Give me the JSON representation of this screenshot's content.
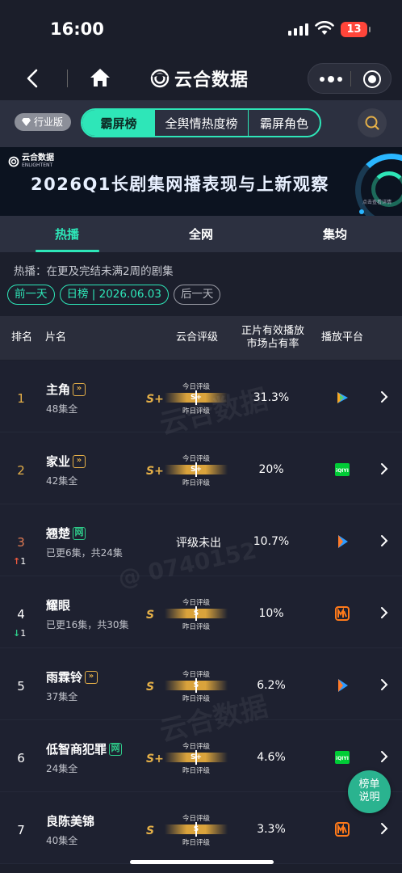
{
  "status": {
    "time": "16:00",
    "battery": "13"
  },
  "navbar": {
    "brand": "云合数据"
  },
  "top_tabs": {
    "industry": "行业版",
    "items": [
      "霸屏榜",
      "全舆情热度榜",
      "霸屏角色"
    ]
  },
  "banner": {
    "logo_main": "云合数据",
    "logo_sub": "ENLIGHTENT",
    "title": "2026Q1长剧集网播表现与上新观察",
    "note": "点击查看详情"
  },
  "sub_tabs": [
    "热播",
    "全网",
    "集均"
  ],
  "hint": "热播：在更及完结未满2周的剧集",
  "date_nav": {
    "prev": "前一天",
    "current": "日榜 | 2026.06.03",
    "next": "后一天"
  },
  "table_header": {
    "rank": "排名",
    "title": "片名",
    "grade": "云合评级",
    "share_line1": "正片有效播放",
    "share_line2": "市场占有率",
    "platform": "播放平台"
  },
  "grade_labels": {
    "today": "今日评级",
    "yesterday": "昨日评级"
  },
  "rows": [
    {
      "rank": "1",
      "title": "主角",
      "badge": "vip",
      "meta": "48集全",
      "grade": "S+",
      "share": "31.3%",
      "platform": "tencent"
    },
    {
      "rank": "2",
      "title": "家业",
      "badge": "vip",
      "meta": "42集全",
      "grade": "S+",
      "share": "20%",
      "platform": "iqiyi"
    },
    {
      "rank": "3",
      "delta": "1",
      "delta_dir": "up",
      "title": "翘楚",
      "badge": "net",
      "meta": "已更6集，共24集",
      "grade": "",
      "no_grade": "评级未出",
      "share": "10.7%",
      "platform": "youku"
    },
    {
      "rank": "4",
      "delta": "1",
      "delta_dir": "down",
      "title": "耀眼",
      "badge": "",
      "meta": "已更16集，共30集",
      "grade": "S",
      "share": "10%",
      "platform": "mango"
    },
    {
      "rank": "5",
      "title": "雨霖铃",
      "badge": "vip",
      "meta": "37集全",
      "grade": "S",
      "share": "6.2%",
      "platform": "youku"
    },
    {
      "rank": "6",
      "title": "低智商犯罪",
      "badge": "net",
      "meta": "24集全",
      "grade": "S+",
      "share": "4.6%",
      "platform": "iqiyi"
    },
    {
      "rank": "7",
      "title": "良陈美锦",
      "badge": "",
      "meta": "40集全",
      "grade": "S",
      "share": "3.3%",
      "platform": "mango"
    }
  ],
  "help_button": {
    "line1": "榜单",
    "line2": "说明"
  },
  "watermarks": {
    "brand": "云合数据",
    "brand_en": "ENLIGHTENT",
    "code": "@ 0740152"
  }
}
